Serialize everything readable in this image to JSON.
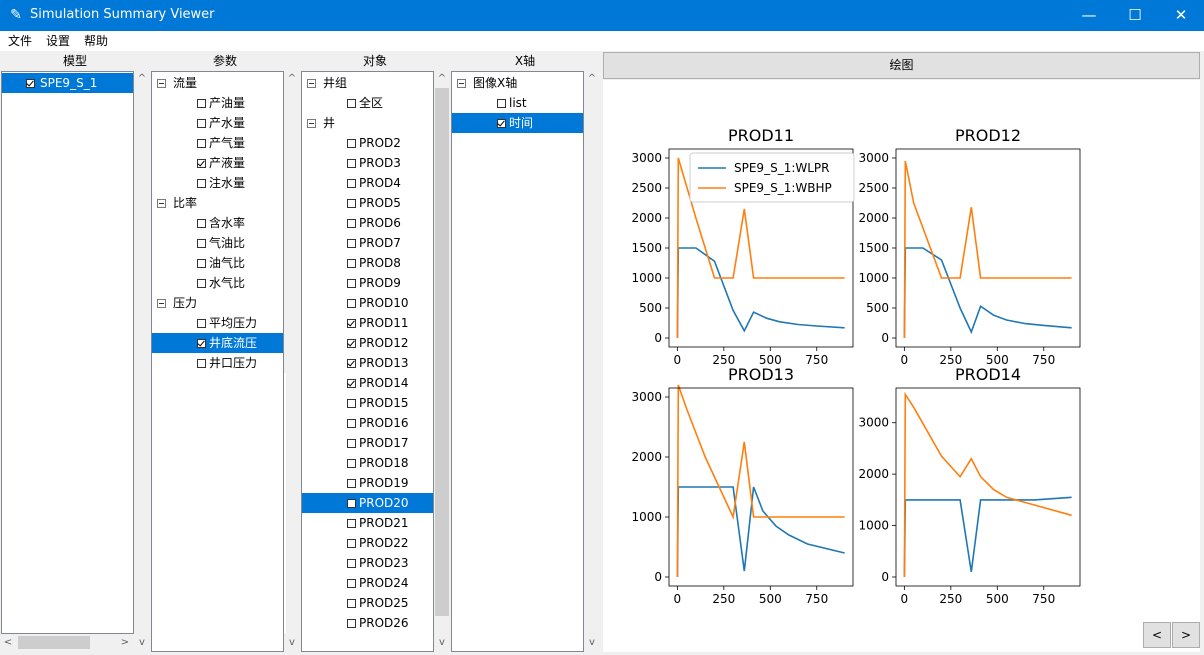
{
  "window": {
    "title": "Simulation Summary Viewer",
    "minimize": "—",
    "maximize": "☐",
    "close": "✕"
  },
  "menu": {
    "items": [
      "文件",
      "设置",
      "帮助"
    ]
  },
  "columns": {
    "model": "模型",
    "params": "参数",
    "objects": "对象",
    "xaxis": "X轴"
  },
  "model_panel": {
    "items": [
      {
        "label": "SPE9_S_1",
        "checked": true,
        "selected": true
      }
    ]
  },
  "params_panel": {
    "groups": [
      {
        "label": "流量",
        "items": [
          {
            "label": "产油量",
            "checked": false
          },
          {
            "label": "产水量",
            "checked": false
          },
          {
            "label": "产气量",
            "checked": false
          },
          {
            "label": "产液量",
            "checked": true
          },
          {
            "label": "注水量",
            "checked": false
          }
        ]
      },
      {
        "label": "比率",
        "items": [
          {
            "label": "含水率",
            "checked": false
          },
          {
            "label": "气油比",
            "checked": false
          },
          {
            "label": "油气比",
            "checked": false
          },
          {
            "label": "水气比",
            "checked": false
          }
        ]
      },
      {
        "label": "压力",
        "items": [
          {
            "label": "平均压力",
            "checked": false
          },
          {
            "label": "井底流压",
            "checked": true,
            "selected": true
          },
          {
            "label": "井口压力",
            "checked": false
          }
        ]
      }
    ]
  },
  "objects_panel": {
    "groups": [
      {
        "label": "井组",
        "items": [
          {
            "label": "全区",
            "checked": false
          }
        ]
      },
      {
        "label": "井",
        "items": [
          {
            "label": "PROD2",
            "checked": false
          },
          {
            "label": "PROD3",
            "checked": false
          },
          {
            "label": "PROD4",
            "checked": false
          },
          {
            "label": "PROD5",
            "checked": false
          },
          {
            "label": "PROD6",
            "checked": false
          },
          {
            "label": "PROD7",
            "checked": false
          },
          {
            "label": "PROD8",
            "checked": false
          },
          {
            "label": "PROD9",
            "checked": false
          },
          {
            "label": "PROD10",
            "checked": false
          },
          {
            "label": "PROD11",
            "checked": true
          },
          {
            "label": "PROD12",
            "checked": true
          },
          {
            "label": "PROD13",
            "checked": true
          },
          {
            "label": "PROD14",
            "checked": true
          },
          {
            "label": "PROD15",
            "checked": false
          },
          {
            "label": "PROD16",
            "checked": false
          },
          {
            "label": "PROD17",
            "checked": false
          },
          {
            "label": "PROD18",
            "checked": false
          },
          {
            "label": "PROD19",
            "checked": false
          },
          {
            "label": "PROD20",
            "checked": false,
            "selected": true
          },
          {
            "label": "PROD21",
            "checked": false
          },
          {
            "label": "PROD22",
            "checked": false
          },
          {
            "label": "PROD23",
            "checked": false
          },
          {
            "label": "PROD24",
            "checked": false
          },
          {
            "label": "PROD25",
            "checked": false
          },
          {
            "label": "PROD26",
            "checked": false
          }
        ]
      }
    ]
  },
  "xaxis_panel": {
    "groups": [
      {
        "label": "图像X轴",
        "items": [
          {
            "label": "list",
            "checked": false
          },
          {
            "label": "时间",
            "checked": true,
            "selected": true
          }
        ]
      }
    ]
  },
  "plot_button": "绘图",
  "nav": {
    "prev": "<",
    "next": ">"
  },
  "scroll_arrows": {
    "left": "<",
    "right": ">",
    "up": "^",
    "down": "v"
  },
  "colors": {
    "series1": "#1f77b4",
    "series2": "#ff7f0e",
    "selection": "#0078d7",
    "titlebar": "#0078d7"
  },
  "chart_data": [
    {
      "type": "line",
      "title": "PROD11",
      "ylim": [
        0,
        3000
      ],
      "yticks": [
        0,
        500,
        1000,
        1500,
        2000,
        2500,
        3000
      ],
      "xticks": [
        0,
        250,
        500,
        750
      ],
      "legend": {
        "position": "top-right",
        "entries": [
          "SPE9_S_1:WLPR",
          "SPE9_S_1:WBHP"
        ]
      },
      "series": [
        {
          "name": "SPE9_S_1:WLPR",
          "x": [
            0,
            5,
            100,
            200,
            300,
            360,
            410,
            480,
            550,
            650,
            750,
            900
          ],
          "y": [
            0,
            1500,
            1500,
            1280,
            460,
            120,
            430,
            330,
            270,
            225,
            200,
            170
          ]
        },
        {
          "name": "SPE9_S_1:WBHP",
          "x": [
            0,
            5,
            100,
            200,
            300,
            360,
            410,
            500,
            650,
            900
          ],
          "y": [
            0,
            3000,
            2000,
            1000,
            1000,
            2150,
            1000,
            1000,
            1000,
            1000
          ]
        }
      ]
    },
    {
      "type": "line",
      "title": "PROD12",
      "ylim": [
        0,
        3000
      ],
      "yticks": [
        0,
        500,
        1000,
        1500,
        2000,
        2500,
        3000
      ],
      "xticks": [
        0,
        250,
        500,
        750
      ],
      "series": [
        {
          "name": "SPE9_S_1:WLPR",
          "x": [
            0,
            5,
            100,
            200,
            300,
            360,
            410,
            480,
            550,
            650,
            750,
            900
          ],
          "y": [
            0,
            1500,
            1500,
            1300,
            500,
            100,
            530,
            380,
            300,
            240,
            210,
            170
          ]
        },
        {
          "name": "SPE9_S_1:WBHP",
          "x": [
            0,
            5,
            50,
            200,
            300,
            360,
            410,
            500,
            650,
            900
          ],
          "y": [
            0,
            2950,
            2250,
            1000,
            1000,
            2180,
            1000,
            1000,
            1000,
            1000
          ]
        }
      ]
    },
    {
      "type": "line",
      "title": "PROD13",
      "ylim": [
        0,
        3000
      ],
      "yticks": [
        0,
        1000,
        2000,
        3000
      ],
      "xticks": [
        0,
        250,
        500,
        750
      ],
      "series": [
        {
          "name": "SPE9_S_1:WLPR",
          "x": [
            0,
            5,
            100,
            200,
            300,
            360,
            410,
            460,
            530,
            600,
            700,
            900
          ],
          "y": [
            0,
            1500,
            1500,
            1500,
            1500,
            100,
            1500,
            1100,
            850,
            700,
            550,
            400
          ]
        },
        {
          "name": "SPE9_S_1:WBHP",
          "x": [
            0,
            5,
            50,
            150,
            300,
            360,
            410,
            500,
            650,
            900
          ],
          "y": [
            0,
            3200,
            2800,
            2000,
            1000,
            2250,
            1000,
            1000,
            1000,
            1000
          ]
        }
      ]
    },
    {
      "type": "line",
      "title": "PROD14",
      "ylim": [
        0,
        3500
      ],
      "yticks": [
        0,
        1000,
        2000,
        3000
      ],
      "xticks": [
        0,
        250,
        500,
        750
      ],
      "series": [
        {
          "name": "SPE9_S_1:WLPR",
          "x": [
            0,
            5,
            100,
            200,
            300,
            360,
            410,
            500,
            700,
            900
          ],
          "y": [
            0,
            1500,
            1500,
            1500,
            1500,
            100,
            1500,
            1500,
            1500,
            1550
          ]
        },
        {
          "name": "SPE9_S_1:WBHP",
          "x": [
            0,
            5,
            50,
            200,
            300,
            360,
            410,
            480,
            550,
            700,
            900
          ],
          "y": [
            0,
            3550,
            3300,
            2350,
            1950,
            2300,
            1950,
            1700,
            1550,
            1400,
            1200
          ]
        }
      ]
    }
  ]
}
